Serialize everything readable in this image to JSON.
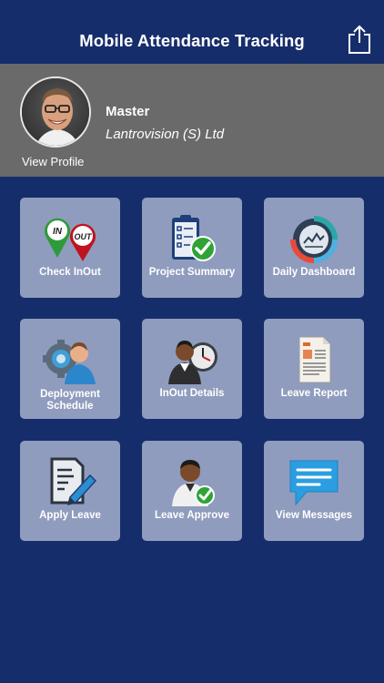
{
  "header": {
    "title": "Mobile Attendance Tracking",
    "share_icon": "share-icon"
  },
  "profile": {
    "name": "Master",
    "company": "Lantrovision (S) Ltd",
    "view_profile_label": "View Profile"
  },
  "tiles": [
    {
      "label": "Check InOut",
      "icon": "check-in-out-icon",
      "in_text": "IN",
      "out_text": "OUT"
    },
    {
      "label": "Project Summary",
      "icon": "clipboard-check-icon"
    },
    {
      "label": "Daily Dashboard",
      "icon": "dashboard-gauge-icon"
    },
    {
      "label_line1": "Deployment",
      "label_line2": "Schedule",
      "icon": "user-gear-icon"
    },
    {
      "label": "InOut Details",
      "icon": "user-clock-icon"
    },
    {
      "label": "Leave Report",
      "icon": "report-document-icon"
    },
    {
      "label": "Apply Leave",
      "icon": "document-pen-icon"
    },
    {
      "label": "Leave Approve",
      "icon": "user-check-icon"
    },
    {
      "label": "View Messages",
      "icon": "chat-bubble-icon"
    }
  ],
  "colors": {
    "background": "#162d6b",
    "profile_band": "#6a6a6a",
    "tile": "#8f9cbd"
  }
}
